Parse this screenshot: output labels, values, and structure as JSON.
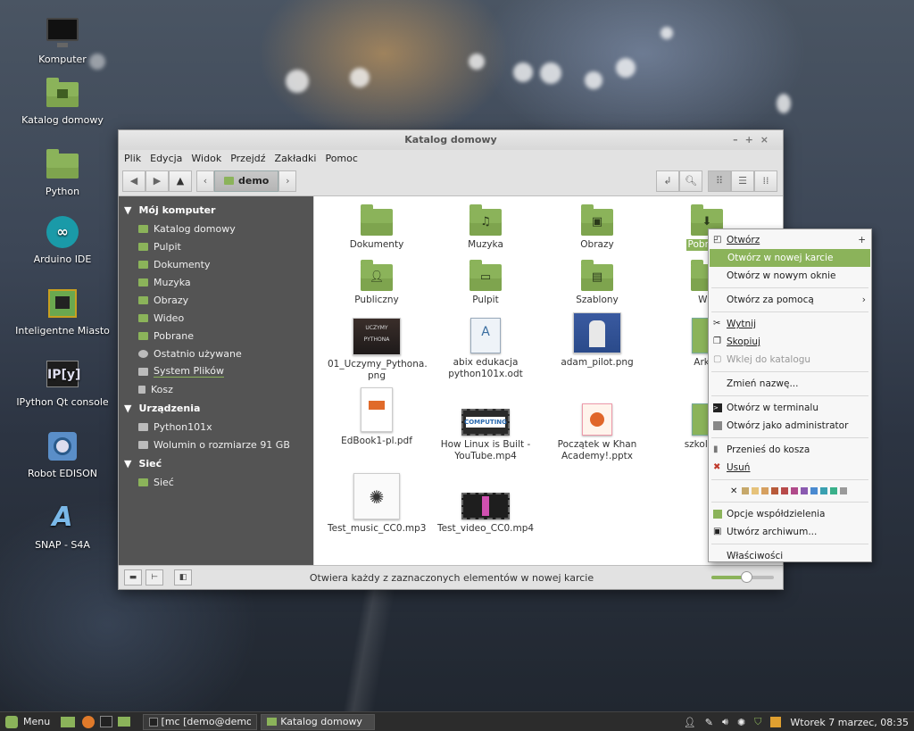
{
  "desktop": {
    "icons": [
      {
        "label": "Komputer",
        "icon": "monitor-icon"
      },
      {
        "label": "Katalog domowy",
        "icon": "home-folder-icon"
      },
      {
        "label": "Python",
        "icon": "folder-icon"
      },
      {
        "label": "Arduino IDE",
        "icon": "arduino-icon"
      },
      {
        "label": "Inteligentne Miasto",
        "icon": "circuit-board-icon"
      },
      {
        "label": "IPython Qt console",
        "icon": "ipython-icon"
      },
      {
        "label": "Robot EDISON",
        "icon": "robot-icon"
      },
      {
        "label": "SNAP - S4A",
        "icon": "snap-icon"
      }
    ]
  },
  "window": {
    "title": "Katalog domowy",
    "controls": [
      "–",
      "+",
      "×"
    ],
    "menu": [
      "Plik",
      "Edycja",
      "Widok",
      "Przejdź",
      "Zakładki",
      "Pomoc"
    ],
    "path": "demo",
    "sidebar": {
      "sections": [
        {
          "title": "Mój komputer",
          "items": [
            "Katalog domowy",
            "Pulpit",
            "Dokumenty",
            "Muzyka",
            "Obrazy",
            "Wideo",
            "Pobrane",
            "Ostatnio używane",
            "System Plików",
            "Kosz"
          ]
        },
        {
          "title": "Urządzenia",
          "items": [
            "Python101x",
            "Wolumin o rozmiarze 91 GB"
          ]
        },
        {
          "title": "Sieć",
          "items": [
            "Sieć"
          ]
        }
      ]
    },
    "files": [
      {
        "name": "Dokumenty"
      },
      {
        "name": "Muzyka"
      },
      {
        "name": "Obrazy"
      },
      {
        "name": "Pobrane"
      },
      {
        "name": "Publiczny"
      },
      {
        "name": "Pulpit"
      },
      {
        "name": "Szablony"
      },
      {
        "name": "Wid"
      },
      {
        "name": "01_Uczymy_Pythona.\npng"
      },
      {
        "name": "abix edukacja\npython101x.odt"
      },
      {
        "name": "adam_pilot.png"
      },
      {
        "name": "Arkus"
      },
      {
        "name": "EdBook1-pl.pdf"
      },
      {
        "name": "How Linux is Built -\nYouTube.mp4"
      },
      {
        "name": "Początek w Khan\nAcademy!.pptx"
      },
      {
        "name": "szkoly_po"
      },
      {
        "name": "Test_music_CC0.mp3"
      },
      {
        "name": "Test_video_CC0.mp4"
      }
    ],
    "status": "Otwiera każdy z zaznaczonych elementów w nowej karcie",
    "zoom_level": 0.55
  },
  "context_menu": {
    "items": [
      {
        "label": "Otwórz",
        "icon": "open-icon",
        "right": "+"
      },
      {
        "label": "Otwórz w nowej karcie",
        "highlight": true
      },
      {
        "label": "Otwórz w nowym oknie"
      },
      {
        "sep": true
      },
      {
        "label": "Otwórz za pomocą",
        "right": "›"
      },
      {
        "sep": true
      },
      {
        "label": "Wytnij",
        "icon": "cut-icon"
      },
      {
        "label": "Skopiuj",
        "icon": "copy-icon"
      },
      {
        "label": "Wklej do katalogu",
        "icon": "paste-icon",
        "disabled": true
      },
      {
        "sep": true
      },
      {
        "label": "Zmień nazwę..."
      },
      {
        "sep": true
      },
      {
        "label": "Otwórz w terminalu",
        "icon": "terminal-icon"
      },
      {
        "label": "Otwórz jako administrator",
        "icon": "admin-icon"
      },
      {
        "sep": true
      },
      {
        "label": "Przenieś do kosza",
        "icon": "trash-icon"
      },
      {
        "label": "Usuń",
        "icon": "delete-icon"
      },
      {
        "sep": true
      },
      {
        "swatches": true
      },
      {
        "sep": true
      },
      {
        "label": "Opcje współdzielenia",
        "icon": "share-icon"
      },
      {
        "label": "Utwórz archiwum...",
        "icon": "archive-icon"
      },
      {
        "sep": true
      },
      {
        "label": "Właściwości"
      }
    ],
    "colors": [
      "#c6a86a",
      "#e6c27a",
      "#d6a060",
      "#b85a3a",
      "#b84a4a",
      "#b04a8a",
      "#8a5ab0",
      "#4a8ad0",
      "#3aa0b0",
      "#3ab08a",
      "#9a9a9a"
    ]
  },
  "taskbar": {
    "menu_label": "Menu",
    "windows": [
      "[mc [demo@demo-k...",
      "Katalog domowy"
    ],
    "clock": "Wtorek  7 marzec, 08:35"
  }
}
